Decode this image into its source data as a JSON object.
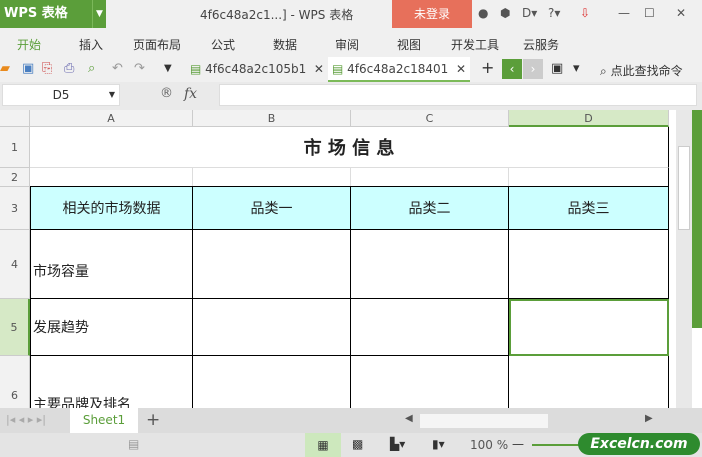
{
  "app": {
    "logo": "WPS 表格",
    "title": "4f6c48a2c1...] - WPS 表格",
    "login": "未登录"
  },
  "menu": [
    "开始",
    "插入",
    "页面布局",
    "公式",
    "数据",
    "审阅",
    "视图",
    "开发工具",
    "云服务"
  ],
  "tabs": [
    {
      "label": "4f6c48a2c105b1"
    },
    {
      "label": "4f6c48a2c18401"
    }
  ],
  "search_label": "点此查找命令",
  "formula": {
    "name_box": "D5",
    "fx": "fx",
    "value": ""
  },
  "columns": [
    "A",
    "B",
    "C",
    "D"
  ],
  "rows": [
    "1",
    "2",
    "3",
    "4",
    "5",
    "6"
  ],
  "sheet": {
    "title": "市 场 信 息",
    "headers": [
      "相关的市场数据",
      "品类一",
      "品类二",
      "品类三"
    ],
    "row_labels": [
      "市场容量",
      "发展趋势",
      "主要品牌及排名"
    ]
  },
  "sheet_tabs": [
    "Sheet1"
  ],
  "status": {
    "zoom": "100 %"
  },
  "watermark": "Excelcn.com",
  "colors": {
    "accent": "#5b9e3a",
    "login": "#e7705b",
    "header_fill": "#ccffff"
  }
}
